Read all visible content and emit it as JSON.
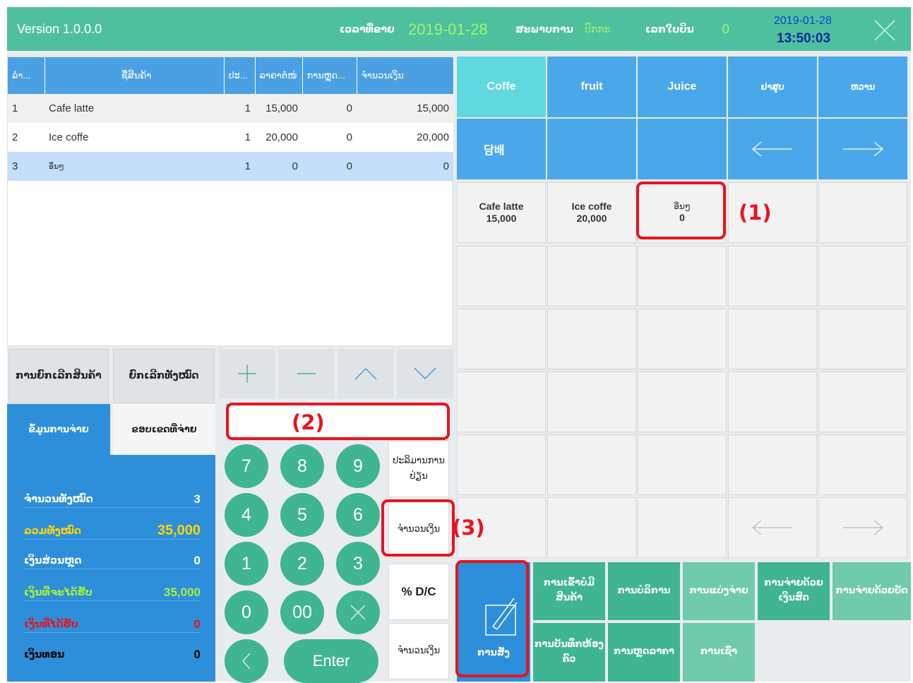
{
  "header": {
    "version": "Version 1.0.0.0",
    "date_label": "ເວລາທີ່ຂາຍ",
    "date": "2019-01-28",
    "status_label": "ສະພາບການ",
    "status_value": "ປົກກະ",
    "bill_label": "ເລກໃບບິນ",
    "bill_value": "0",
    "clock_date": "2019-01-28",
    "clock_time": "13:50:03"
  },
  "order_table": {
    "columns": [
      "ລຳ...",
      "ຊື່ສິນຄ້າ",
      "ປະ...",
      "ລາຄາຕໍ່ໜ່",
      "ການຫຼຸດ...",
      "ຈຳນວນເງິນ"
    ],
    "rows": [
      {
        "no": "1",
        "name": "Cafe latte",
        "qty": "1",
        "price": "15,000",
        "discount": "0",
        "amount": "15,000"
      },
      {
        "no": "2",
        "name": "Ice coffe",
        "qty": "1",
        "price": "20,000",
        "discount": "0",
        "amount": "20,000"
      },
      {
        "no": "3",
        "name": "ອື່ນໆ",
        "qty": "1",
        "price": "0",
        "discount": "0",
        "amount": "0"
      }
    ]
  },
  "controls": {
    "cancel_item": "ການຍົກເລີກສິນຄ້າ",
    "cancel_all": "ຍົກເລີກທັງໝົດ"
  },
  "payment": {
    "tab_info": "ຂໍ້ມູນການຈ່າຍ",
    "tab_check": "ຂອບເຂດທີ່ຈ່າຍ",
    "rows": [
      {
        "label": "ຈຳນວນທັງໝົດ",
        "value": "3",
        "color": "#ffffff"
      },
      {
        "label": "ລວມທັງໝົດ",
        "value": "35,000",
        "color": "#ffd400"
      },
      {
        "label": "ເງິນສ່ວນຫຼຸດ",
        "value": "0",
        "color": "#ffffff"
      },
      {
        "label": "ເງິນທີ່ຈະໄດ້ຮັບ",
        "value": "35,000",
        "color": "#a6f03c"
      },
      {
        "label": "ເງິນທີ່ໄດ້ຮັບ",
        "value": "0",
        "color": "#e8141e"
      },
      {
        "label": "ເງິນທອນ",
        "value": "0",
        "color": "#000000"
      }
    ]
  },
  "keypad": {
    "keys": [
      "7",
      "8",
      "9",
      "4",
      "5",
      "6",
      "1",
      "2",
      "3",
      "0",
      "00"
    ],
    "enter": "Enter",
    "side": {
      "adjust_qty": "ປະລິມານການປ່ຽນ",
      "amount_top": "ຈຳນວນເງິນ",
      "dc": "% D/C",
      "amount_bottom": "ຈຳນວນເງິນ"
    }
  },
  "categories": [
    "Coffe",
    "fruit",
    "Juice",
    "ຢາສູບ",
    "ຫວານ",
    "담배"
  ],
  "products": [
    {
      "name": "Cafe latte",
      "price": "15,000"
    },
    {
      "name": "Ice coffe",
      "price": "20,000"
    },
    {
      "name": "ອື່ນໆ",
      "price": "0"
    }
  ],
  "actions": {
    "order": "ການສັ່ງ",
    "import_items": "ການເຂົ້າບໍ່ມີສິນຄ້າ",
    "service": "ການບໍລິການ",
    "split_pay": "ການແບ່ງຈ່າຍ",
    "pay_cash": "ການຈ່າຍດ້ວຍເງິນສົດ",
    "pay_card": "ການຈ່າຍດ້ວຍບັດ",
    "save_room": "ການບັນທຶກຫ້ອງຄົວ",
    "price_discount": "ການຫຼຸດລາຄາ",
    "rent": "ການເຊົ່າ"
  },
  "callouts": [
    "(1)",
    "(2)",
    "(3)"
  ]
}
